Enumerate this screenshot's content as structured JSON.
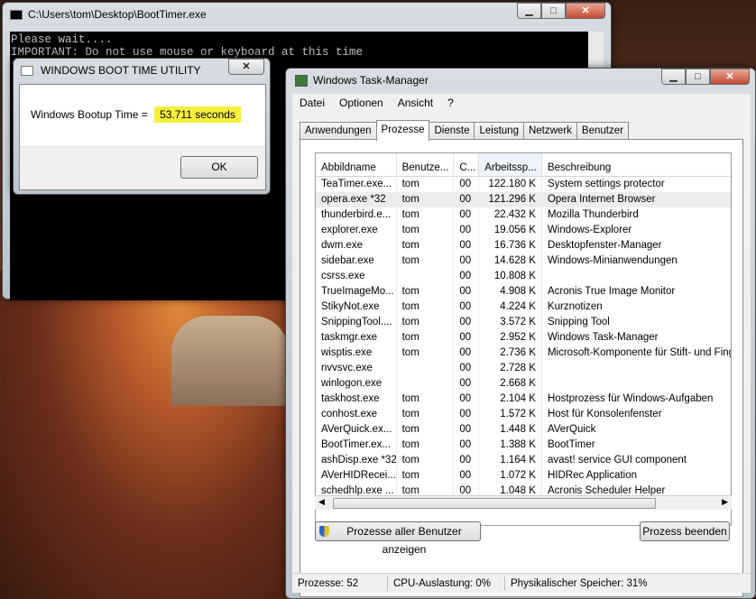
{
  "console": {
    "title": "C:\\Users\\tom\\Desktop\\BootTimer.exe",
    "lines": [
      "Please wait....",
      "IMPORTANT: Do not use mouse or keyboard at this time"
    ]
  },
  "dialog": {
    "title": "WINDOWS BOOT TIME UTILITY",
    "message_label": "Windows Bootup Time =",
    "message_value": "53.711  seconds",
    "ok_label": "OK"
  },
  "taskmanager": {
    "title": "Windows Task-Manager",
    "menus": [
      "Datei",
      "Optionen",
      "Ansicht",
      "?"
    ],
    "tabs": [
      "Anwendungen",
      "Prozesse",
      "Dienste",
      "Leistung",
      "Netzwerk",
      "Benutzer"
    ],
    "active_tab": "Prozesse",
    "columns": [
      "Abbildname",
      "Benutze...",
      "C...",
      "Arbeitssp...",
      "Beschreibung"
    ],
    "rows": [
      [
        "TeaTimer.exe...",
        "tom",
        "00",
        "122.180 K",
        "System settings protector"
      ],
      [
        "opera.exe *32",
        "tom",
        "00",
        "121.296 K",
        "Opera Internet Browser"
      ],
      [
        "thunderbird.e...",
        "tom",
        "00",
        "22.432 K",
        "Mozilla Thunderbird"
      ],
      [
        "explorer.exe",
        "tom",
        "00",
        "19.056 K",
        "Windows-Explorer"
      ],
      [
        "dwm.exe",
        "tom",
        "00",
        "16.736 K",
        "Desktopfenster-Manager"
      ],
      [
        "sidebar.exe",
        "tom",
        "00",
        "14.628 K",
        "Windows-Minianwendungen"
      ],
      [
        "csrss.exe",
        "",
        "00",
        "10.808 K",
        ""
      ],
      [
        "TrueImageMo...",
        "tom",
        "00",
        "4.908 K",
        "Acronis True Image Monitor"
      ],
      [
        "StikyNot.exe",
        "tom",
        "00",
        "4.224 K",
        "Kurznotizen"
      ],
      [
        "SnippingTool....",
        "tom",
        "00",
        "3.572 K",
        "Snipping Tool"
      ],
      [
        "taskmgr.exe",
        "tom",
        "00",
        "2.952 K",
        "Windows Task-Manager"
      ],
      [
        "wisptis.exe",
        "tom",
        "00",
        "2.736 K",
        "Microsoft-Komponente für Stift- und Finge"
      ],
      [
        "nvvsvc.exe",
        "",
        "00",
        "2.728 K",
        ""
      ],
      [
        "winlogon.exe",
        "",
        "00",
        "2.668 K",
        ""
      ],
      [
        "taskhost.exe",
        "tom",
        "00",
        "2.104 K",
        "Hostprozess für Windows-Aufgaben"
      ],
      [
        "conhost.exe",
        "tom",
        "00",
        "1.572 K",
        "Host für Konsolenfenster"
      ],
      [
        "AVerQuick.ex...",
        "tom",
        "00",
        "1.448 K",
        "AVerQuick"
      ],
      [
        "BootTimer.ex...",
        "tom",
        "00",
        "1.388 K",
        "BootTimer"
      ],
      [
        "ashDisp.exe *32",
        "tom",
        "00",
        "1.164 K",
        "avast! service GUI component"
      ],
      [
        "AVerHIDRecei...",
        "tom",
        "00",
        "1.072 K",
        "HIDRec Application"
      ],
      [
        "schedhlp.exe ...",
        "tom",
        "00",
        "1.048 K",
        "Acronis Scheduler Helper"
      ]
    ],
    "selected_row": 1,
    "show_all_label": "Prozesse aller Benutzer anzeigen",
    "end_process_label": "Prozess beenden",
    "status": {
      "processes": "Prozesse: 52",
      "cpu": "CPU-Auslastung: 0%",
      "memory": "Physikalischer Speicher: 31%"
    }
  }
}
